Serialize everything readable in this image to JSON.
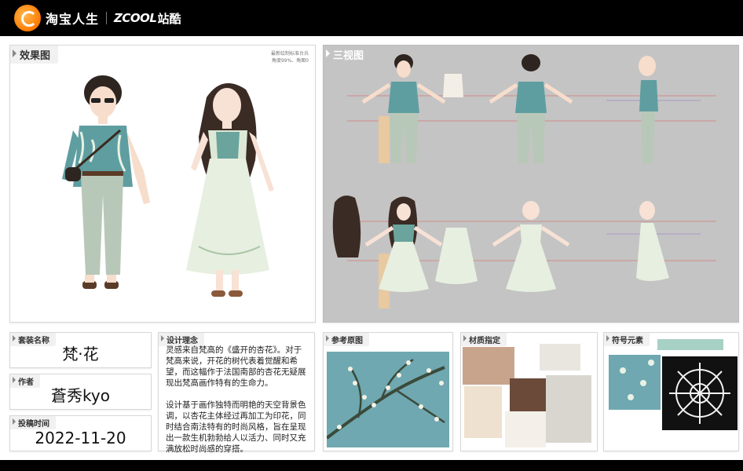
{
  "header": {
    "brand_cn": "淘宝人生",
    "brand_zcool": "ZCOOL",
    "brand_zcool_cn": "站酷"
  },
  "panels": {
    "effect": {
      "title": "效果图",
      "note_line1": "最新绘制标准台兵",
      "note_line2": "角度99%、角面0"
    },
    "three_view": {
      "title": "三视图"
    },
    "name": {
      "title": "套装名称",
      "value": "梵·花"
    },
    "author": {
      "title": "作者",
      "value": "蒼秀kyo"
    },
    "date": {
      "title": "投稿时间",
      "value": "2022-11-20"
    },
    "concept": {
      "title": "设计理念",
      "paragraph1": "灵感来自梵高的《盛开的杏花》。对于梵高来说，开花的树代表着觉醒和希望，而这幅作于法国南部的杏花无疑展现出梵高画作特有的生命力。",
      "paragraph2": "设计基于画作独特而明艳的天空背景色调，以杏花主体经过再加工为印花，同时结合南法特有的时尚风格，旨在呈现出一款生机勃勃给人以活力、同时又充满放松时尚感的穿搭。"
    },
    "reference": {
      "title": "参考原图"
    },
    "material": {
      "title": "材质指定"
    },
    "symbol": {
      "title": "符号元素"
    }
  },
  "colors": {
    "topbar": "#000000",
    "teal_fabric": "#5f9ea0",
    "sage_pants": "#b8c8b8",
    "dress_green": "#dde9d6",
    "three_view_bg": "#c4c4c4",
    "accent_red_line": "#d9534f",
    "accent_purple_line": "#8e6fc7"
  }
}
